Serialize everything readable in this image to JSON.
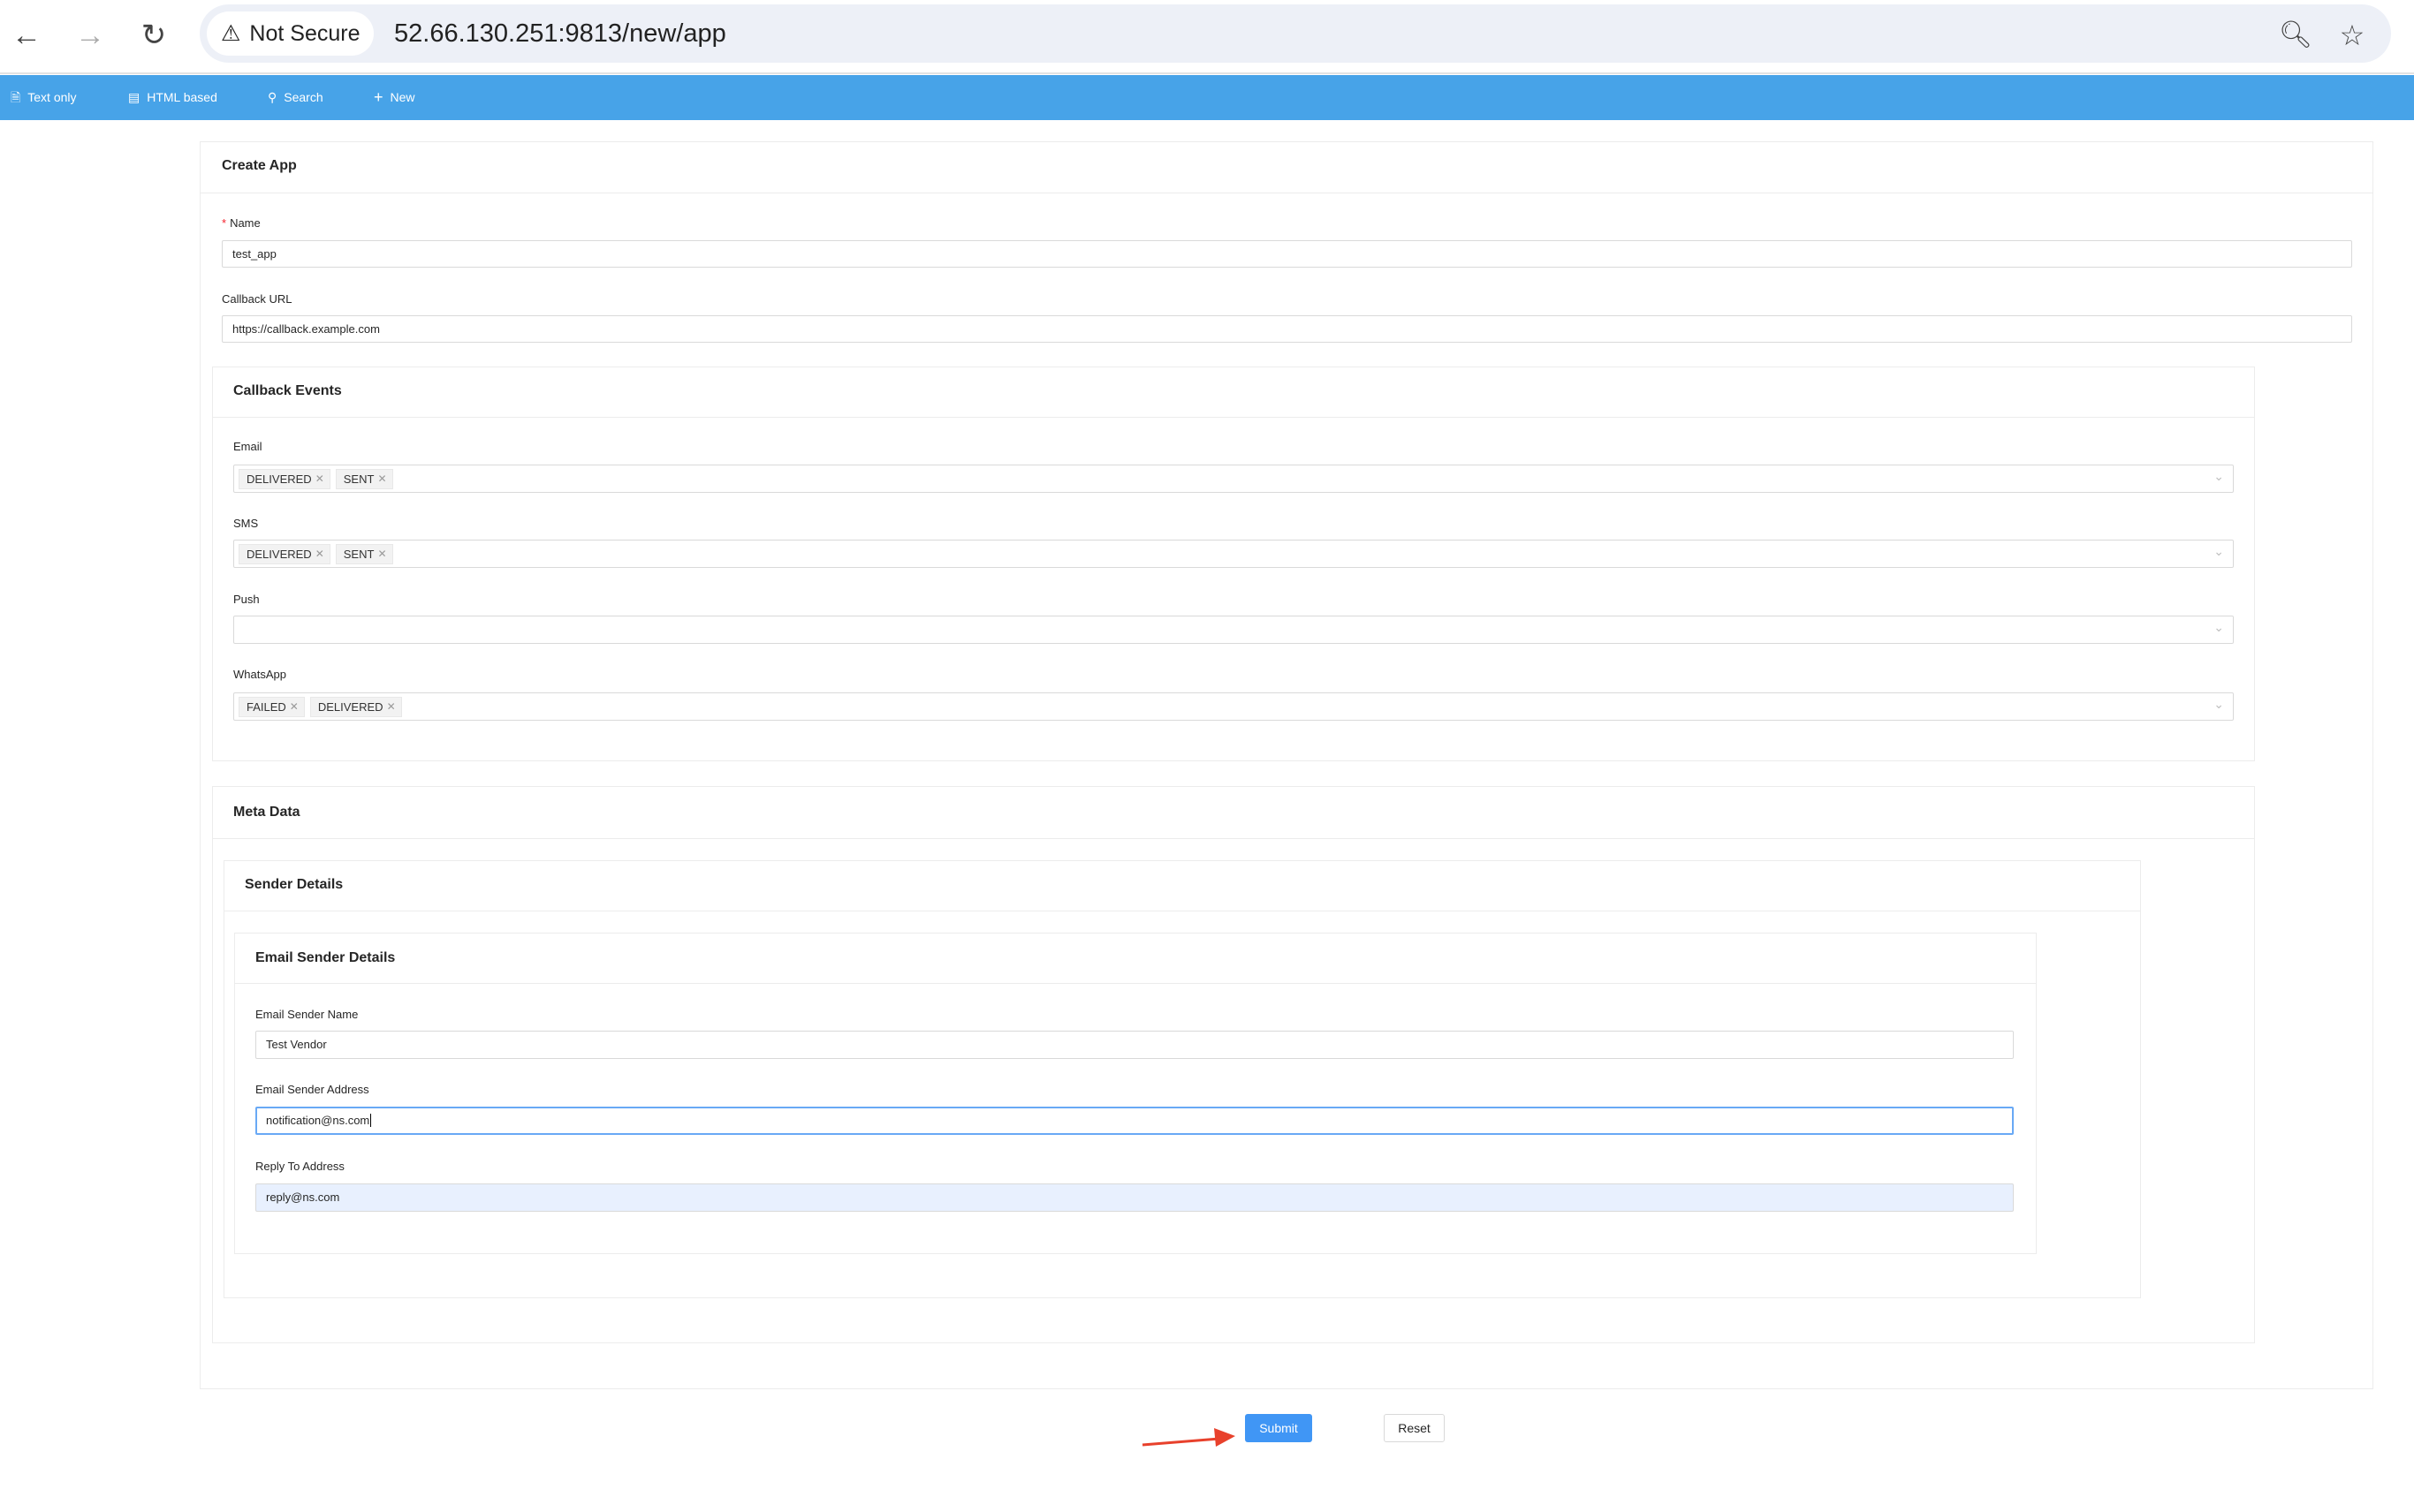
{
  "browser": {
    "security_label": "Not Secure",
    "url": "52.66.130.251:9813/new/app"
  },
  "toolbar": {
    "items": [
      {
        "label": "Text only",
        "icon": "file-text-icon"
      },
      {
        "label": "HTML based",
        "icon": "html5-icon"
      },
      {
        "label": "Search",
        "icon": "search-icon"
      },
      {
        "label": "New",
        "icon": "plus-icon"
      }
    ]
  },
  "form": {
    "title": "Create App",
    "name": {
      "label": "Name",
      "value": "test_app"
    },
    "callback_url": {
      "label": "Callback URL",
      "value": "https://callback.example.com"
    },
    "callback_events": {
      "title": "Callback Events",
      "email": {
        "label": "Email",
        "tags": [
          "DELIVERED",
          "SENT"
        ]
      },
      "sms": {
        "label": "SMS",
        "tags": [
          "DELIVERED",
          "SENT"
        ]
      },
      "push": {
        "label": "Push",
        "tags": []
      },
      "whatsapp": {
        "label": "WhatsApp",
        "tags": [
          "FAILED",
          "DELIVERED"
        ]
      }
    },
    "meta": {
      "title": "Meta Data",
      "sender": {
        "title": "Sender Details",
        "email": {
          "title": "Email Sender Details",
          "name": {
            "label": "Email Sender Name",
            "value": "Test Vendor"
          },
          "address": {
            "label": "Email Sender Address",
            "value": "notification@ns.com"
          },
          "reply": {
            "label": "Reply To Address",
            "value": "reply@ns.com"
          }
        }
      }
    },
    "submit_label": "Submit",
    "reset_label": "Reset"
  },
  "colors": {
    "toolbar": "#47a3e8",
    "primary": "#4096f5",
    "annotation_arrow": "#e8412c"
  }
}
